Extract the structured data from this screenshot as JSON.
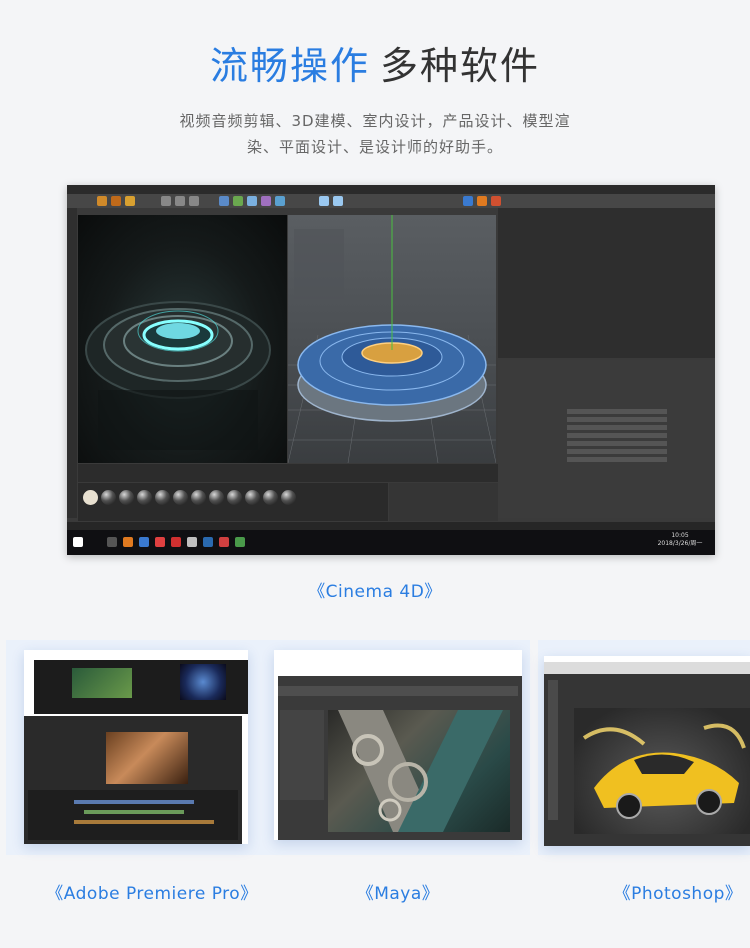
{
  "header": {
    "title_accent": "流畅操作",
    "title_rest": "多种软件",
    "subtitle": "视频音频剪辑、3D建模、室内设计，产品设计、模型渲染、平面设计、是设计师的好助手。"
  },
  "main_screenshot": {
    "caption": "《Cinema 4D》",
    "taskbar_time": "10:05",
    "taskbar_date": "2018/3/26/周一"
  },
  "software": [
    {
      "caption": "《Adobe Premiere Pro》"
    },
    {
      "caption": "《Maya》"
    },
    {
      "caption": "《Photoshop》"
    }
  ],
  "colors": {
    "accent": "#2a7de1",
    "headline_dark": "#333333",
    "subtitle": "#666666",
    "background": "#f4f5f7"
  },
  "icons": {
    "windows_start": "windows-logo-icon",
    "render_object": "glowing-disc-render"
  }
}
